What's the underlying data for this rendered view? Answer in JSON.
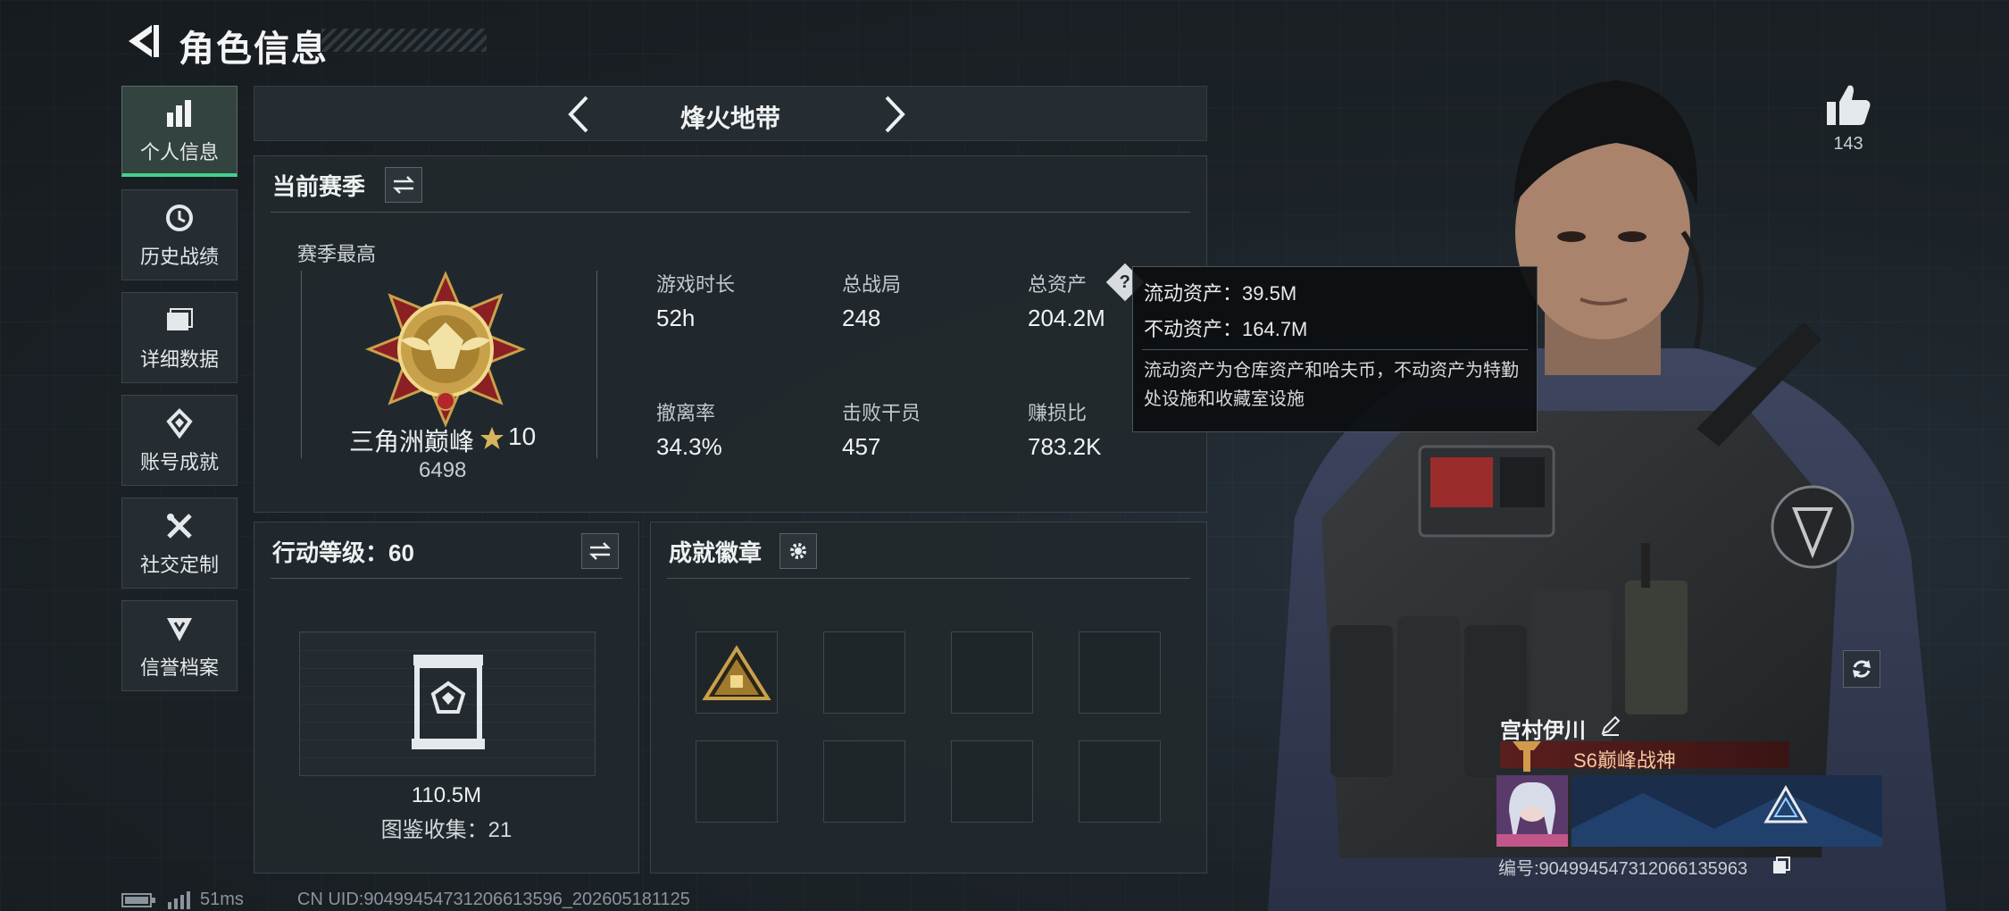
{
  "header": {
    "title": "角色信息"
  },
  "sidebar": {
    "items": [
      {
        "label": "个人信息",
        "icon": "bar-chart-icon",
        "active": true
      },
      {
        "label": "历史战绩",
        "icon": "history-icon",
        "active": false
      },
      {
        "label": "详细数据",
        "icon": "folder-icon",
        "active": false
      },
      {
        "label": "账号成就",
        "icon": "achievement-icon",
        "active": false
      },
      {
        "label": "社交定制",
        "icon": "tools-icon",
        "active": false
      },
      {
        "label": "信誉档案",
        "icon": "shield-icon",
        "active": false
      }
    ]
  },
  "mode": {
    "title": "烽火地带"
  },
  "season": {
    "heading": "当前赛季",
    "best_label": "赛季最高",
    "rank_name": "三角洲巅峰",
    "rank_stars": "10",
    "rank_points": "6498",
    "stats": [
      {
        "label": "游戏时长",
        "value": "52h"
      },
      {
        "label": "总战局",
        "value": "248"
      },
      {
        "label": "总资产",
        "value": "204.2M"
      },
      {
        "label": "撤离率",
        "value": "34.3%"
      },
      {
        "label": "击败干员",
        "value": "457"
      },
      {
        "label": "赚损比",
        "value": "783.2K"
      }
    ]
  },
  "tooltip": {
    "liquid": "流动资产：39.5M",
    "fixed": "不动资产：164.7M",
    "description": "流动资产为仓库资产和哈夫币，不动资产为特勤处设施和收藏室设施"
  },
  "level": {
    "heading": "行动等级：60",
    "value": "110.5M",
    "collection": "图鉴收集：21"
  },
  "badges": {
    "heading": "成就徽章"
  },
  "character": {
    "likes": "143",
    "name": "宫村伊川",
    "title": "S6巅峰战神",
    "uid": "编号:904994547312066135963"
  },
  "footer": {
    "ping": "51ms",
    "uid_line": "CN UID:9049945473120661359­6_202605181125"
  },
  "colors": {
    "accent": "#43d08e",
    "rank_red": "#5a1e1e",
    "gold": "#c9a14a"
  }
}
